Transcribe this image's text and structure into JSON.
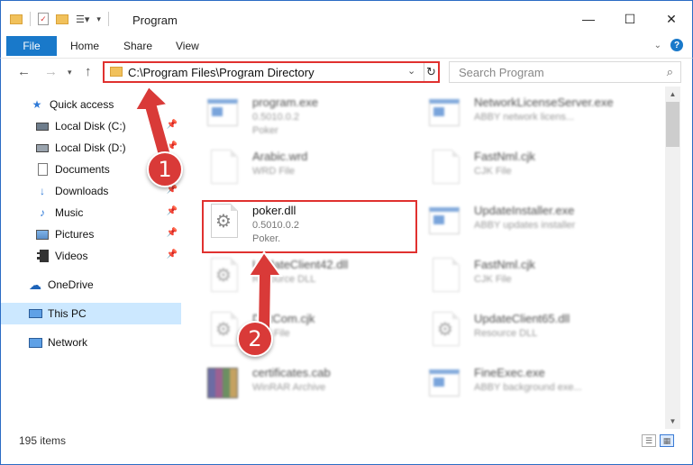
{
  "window": {
    "title": "Program",
    "minimize": "—",
    "maximize": "☐",
    "close": "✕"
  },
  "ribbon": {
    "file": "File",
    "home": "Home",
    "share": "Share",
    "view": "View",
    "help": "?"
  },
  "address": {
    "path": "C:\\Program Files\\Program Directory",
    "search_placeholder": "Search Program"
  },
  "nav": {
    "quick_access": "Quick access",
    "items": [
      {
        "label": "Local Disk (C:)",
        "pinned": true
      },
      {
        "label": "Local Disk (D:)",
        "pinned": true
      },
      {
        "label": "Documents",
        "pinned": true
      },
      {
        "label": "Downloads",
        "pinned": true
      },
      {
        "label": "Music",
        "pinned": true
      },
      {
        "label": "Pictures",
        "pinned": true
      },
      {
        "label": "Videos",
        "pinned": true
      }
    ],
    "onedrive": "OneDrive",
    "thispc": "This PC",
    "network": "Network"
  },
  "files": [
    {
      "name": "program.exe",
      "meta1": "0.5010.0.2",
      "meta2": "Poker",
      "icon": "exe-icon",
      "blurred": true
    },
    {
      "name": "NetworkLicenseServer.exe",
      "meta1": "ABBY network licens...",
      "meta2": "",
      "icon": "exe-icon",
      "blurred": true
    },
    {
      "name": "Arabic.wrd",
      "meta1": "WRD File",
      "meta2": "",
      "icon": "doc-icon",
      "blurred": true
    },
    {
      "name": "FastNml.cjk",
      "meta1": "CJK File",
      "meta2": "",
      "icon": "doc-icon",
      "blurred": true
    },
    {
      "name": "poker.dll",
      "meta1": "0.5010.0.2",
      "meta2": "Poker.",
      "icon": "dll-icon",
      "blurred": false
    },
    {
      "name": "UpdateInstaller.exe",
      "meta1": "ABBY updates installer",
      "meta2": "",
      "icon": "exe-icon",
      "blurred": true
    },
    {
      "name": "UpdateClient42.dll",
      "meta1": "Resource DLL",
      "meta2": "",
      "icon": "dll-icon",
      "blurred": true
    },
    {
      "name": "FastNml.cjk",
      "meta1": "CJK File",
      "meta2": "",
      "icon": "doc-icon",
      "blurred": true
    },
    {
      "name": "DictCom.cjk",
      "meta1": "CJK File",
      "meta2": "",
      "icon": "dll-icon",
      "blurred": true
    },
    {
      "name": "UpdateClient65.dll",
      "meta1": "Resource DLL",
      "meta2": "",
      "icon": "dll-icon",
      "blurred": true
    },
    {
      "name": "certificates.cab",
      "meta1": "WinRAR Archive",
      "meta2": "",
      "icon": "rar-icon",
      "blurred": true
    },
    {
      "name": "FineExec.exe",
      "meta1": "ABBY background exe...",
      "meta2": "",
      "icon": "exe-icon",
      "blurred": true
    }
  ],
  "status": {
    "count": "195 items"
  },
  "annotations": {
    "step1": "1",
    "step2": "2",
    "color": "#d93a38"
  }
}
